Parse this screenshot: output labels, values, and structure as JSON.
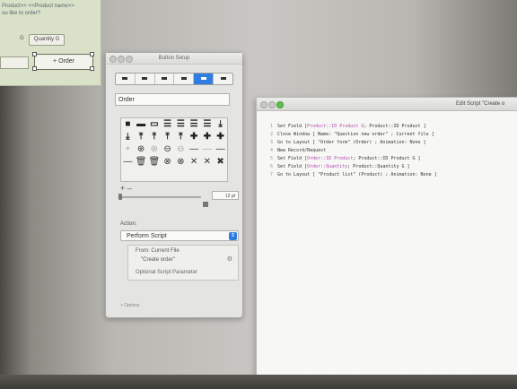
{
  "layout": {
    "header_line1": "Product>> <<Product name>>",
    "header_line2": "ou like to order?",
    "qty_prefix": "G",
    "quantity_field": "Quantity G",
    "order_button": "+ Order"
  },
  "button_setup": {
    "title": "Button Setup",
    "label_value": "Order",
    "grid_add_remove": "+ –",
    "icon_size": "12 pt",
    "action_label": "Action:",
    "action_value": "Perform Script",
    "from_label": "From: Current File",
    "script_name": "\"Create order\"",
    "optional_param": "Optional Script Parameter",
    "options_label": "> Options",
    "icons": [
      "■",
      "▬",
      "▭",
      "☰",
      "☰",
      "☰",
      "☰",
      "⤓",
      "⤓",
      "⤒",
      "⤒",
      "⤒",
      "⤒",
      "✚",
      "✚",
      "✚",
      "+",
      "⊕",
      "⊕",
      "⊖",
      "⊖",
      "—",
      "—",
      "—",
      "—",
      "🗑",
      "🗑",
      "⊗",
      "⊗",
      "✕",
      "✕",
      "✖",
      "",
      "",
      "",
      "",
      "",
      "",
      "",
      ""
    ]
  },
  "edit_script": {
    "title": "Edit Script \"Create o",
    "lines": [
      {
        "n": "1",
        "a": "Set Field [ ",
        "b": "Product::ID Product G",
        "c": " ; Product::ID Product ]"
      },
      {
        "n": "2",
        "a": "Close Window [ Name: \"Question new order\" ; Current file ]",
        "b": "",
        "c": ""
      },
      {
        "n": "3",
        "a": "Go to Layout [ \"Order form\" (Order) ; Animation: None ]",
        "b": "",
        "c": ""
      },
      {
        "n": "4",
        "a": "New Record/Request",
        "b": "",
        "c": ""
      },
      {
        "n": "5",
        "a": "Set Field [ ",
        "b": "Order::ID Product",
        "c": " ; Product::ID Product G ]"
      },
      {
        "n": "6",
        "a": "Set Field [ ",
        "b": "Order::Quantity",
        "c": " ; Product::Quantity G ]"
      },
      {
        "n": "7",
        "a": "Go to Layout [ \"Product list\" (Product) ; Animation: None ]",
        "b": "",
        "c": ""
      }
    ]
  }
}
